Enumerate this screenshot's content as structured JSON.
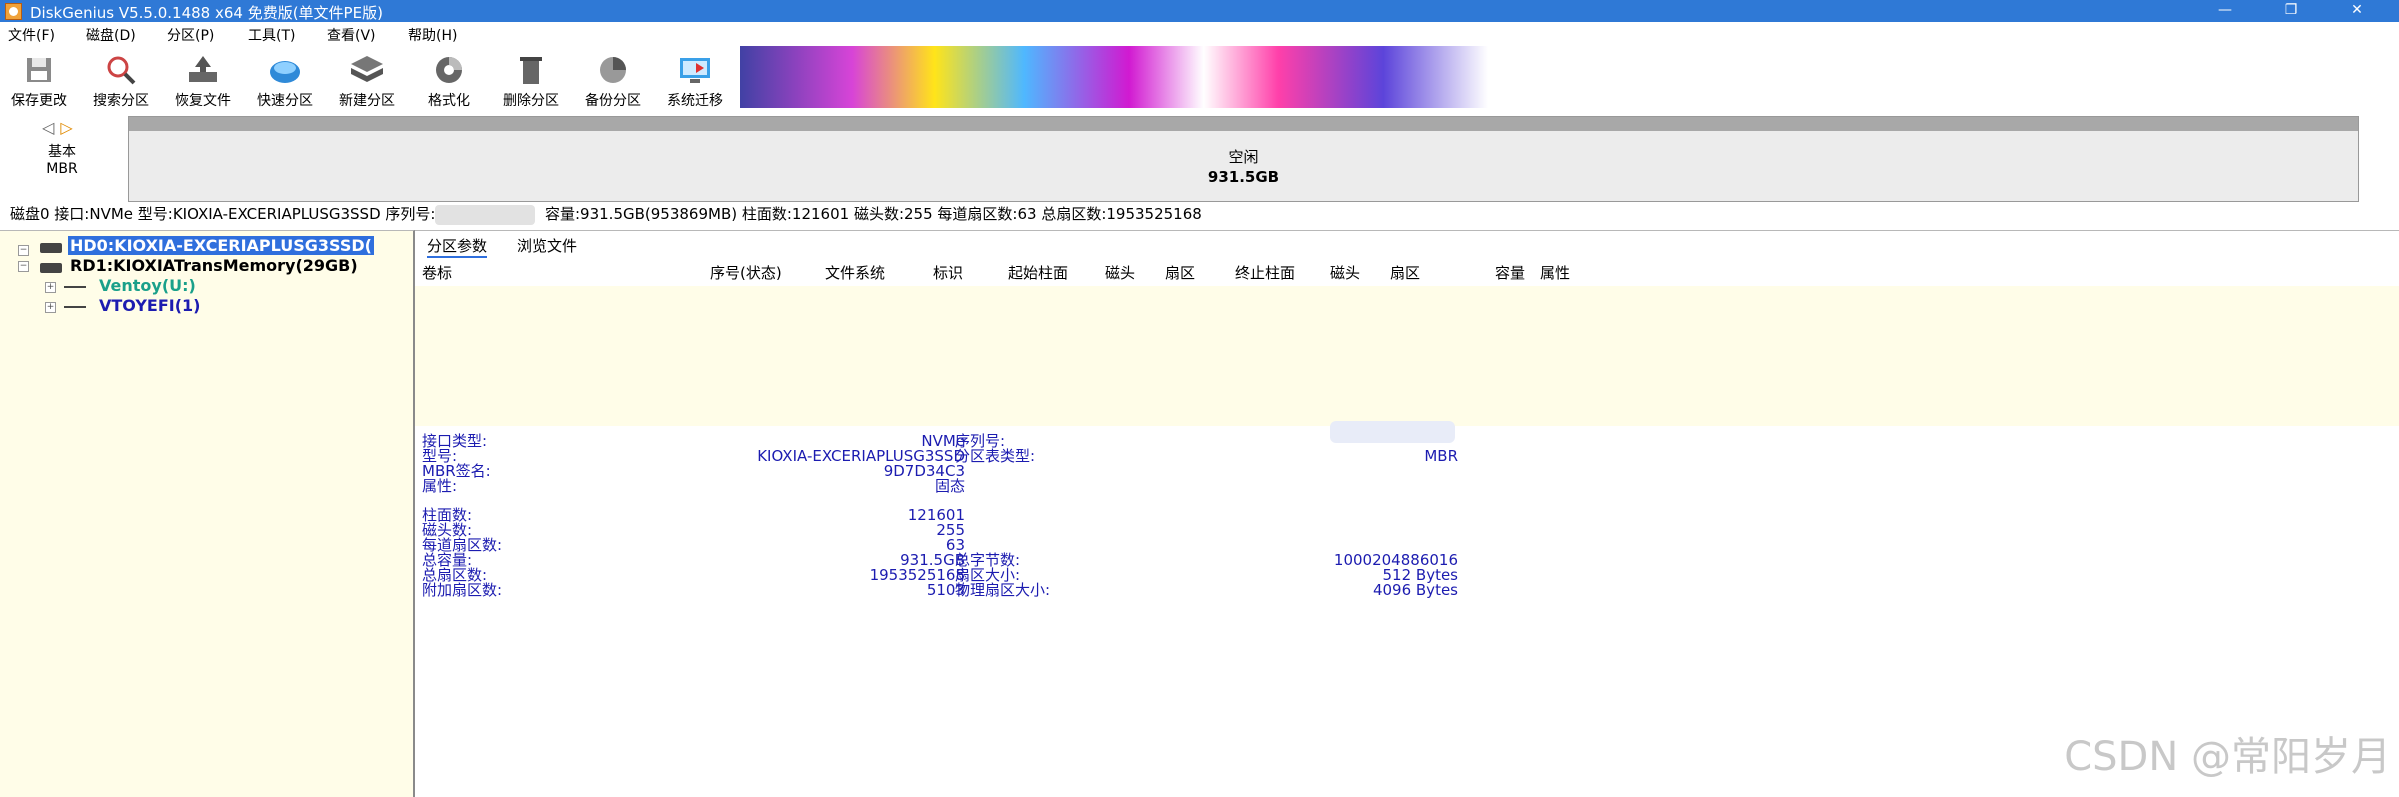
{
  "window": {
    "title": "DiskGenius V5.5.0.1488 x64 免费版(单文件PE版)",
    "controls": {
      "minimize": "—",
      "maximize": "❐",
      "close": "✕"
    }
  },
  "menu": [
    "文件(F)",
    "磁盘(D)",
    "分区(P)",
    "工具(T)",
    "查看(V)",
    "帮助(H)"
  ],
  "toolbar": [
    {
      "label": "保存更改",
      "icon": "save-icon"
    },
    {
      "label": "搜索分区",
      "icon": "search-icon"
    },
    {
      "label": "恢复文件",
      "icon": "restore-file-icon"
    },
    {
      "label": "快速分区",
      "icon": "quick-partition-icon"
    },
    {
      "label": "新建分区",
      "icon": "new-partition-icon"
    },
    {
      "label": "格式化",
      "icon": "format-icon"
    },
    {
      "label": "删除分区",
      "icon": "delete-partition-icon"
    },
    {
      "label": "备份分区",
      "icon": "backup-partition-icon"
    },
    {
      "label": "系统迁移",
      "icon": "system-migration-icon"
    }
  ],
  "diskmap": {
    "type_line1": "基本",
    "type_line2": "MBR",
    "bar_label1": "空闲",
    "bar_label2": "931.5GB"
  },
  "disk_info": {
    "part1": "磁盘0 接口:NVMe 型号:KIOXIA-EXCERIAPLUSG3SSD 序列号:",
    "part2": "容量:931.5GB(953869MB) 柱面数:121601 磁头数:255 每道扇区数:63 总扇区数:1953525168"
  },
  "tree": {
    "hd0": "HD0:KIOXIA-EXCERIAPLUSG3SSD(",
    "rd1": "RD1:KIOXIATransMemory(29GB)",
    "ventoy": "Ventoy(U:)",
    "vtoyefi": "VTOYEFI(1)",
    "colors": {
      "ventoy": "#1aa08a",
      "vtoyefi": "#1c1cb0",
      "selected_bg": "#2f6fdd"
    }
  },
  "tabs": [
    "分区参数",
    "浏览文件"
  ],
  "columns": [
    "卷标",
    "序号(状态)",
    "文件系统",
    "标识",
    "起始柱面",
    "磁头",
    "扇区",
    "终止柱面",
    "磁头",
    "扇区",
    "容量",
    "属性"
  ],
  "details": {
    "interface_label": "接口类型:",
    "interface_value": "NVMe",
    "serial_label": "序列号:",
    "model_label": "型号:",
    "model_value": "KIOXIA-EXCERIAPLUSG3SSD",
    "pt_label": "分区表类型:",
    "pt_value": "MBR",
    "mbr_sig_label": "MBR签名:",
    "mbr_sig_value": "9D7D34C3",
    "attr_label": "属性:",
    "attr_value": "固态",
    "cyl_label": "柱面数:",
    "cyl_value": "121601",
    "heads_label": "磁头数:",
    "heads_value": "255",
    "spt_label": "每道扇区数:",
    "spt_value": "63",
    "cap_label": "总容量:",
    "cap_value": "931.5GB",
    "bytes_label": "总字节数:",
    "bytes_value": "1000204886016",
    "sectors_label": "总扇区数:",
    "sectors_value": "1953525168",
    "sector_size_label": "扇区大小:",
    "sector_size_value": "512 Bytes",
    "extra_label": "附加扇区数:",
    "extra_value": "5103",
    "phys_label": "物理扇区大小:",
    "phys_value": "4096 Bytes"
  },
  "watermark": "CSDN @常阳岁月"
}
